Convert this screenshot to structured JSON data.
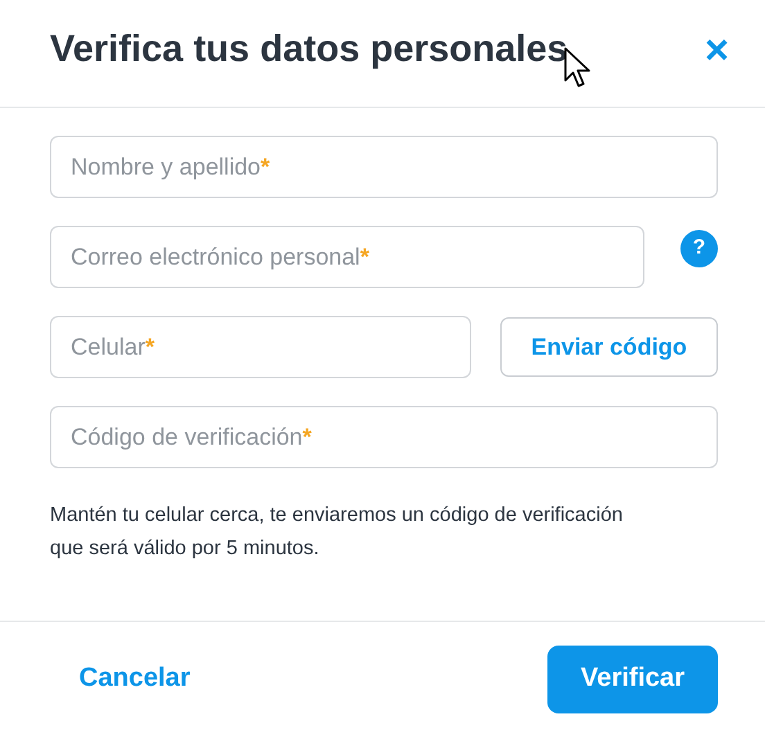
{
  "dialog": {
    "title": "Verifica tus datos personales",
    "close": "×"
  },
  "fields": [
    {
      "kind": "plain",
      "placeholder": "Nombre y apellido",
      "required_mark": "*"
    },
    {
      "kind": "help",
      "placeholder": "Correo electrónico personal",
      "required_mark": "*",
      "help": "?"
    },
    {
      "kind": "action",
      "placeholder": "Celular",
      "required_mark": "*",
      "action": "Enviar código"
    },
    {
      "kind": "plain",
      "placeholder": "Código de verificación",
      "required_mark": "*"
    }
  ],
  "note": "Mantén tu celular cerca, te enviaremos un código de verificación que será válido por 5 minutos.",
  "footer": {
    "cancel": "Cancelar",
    "submit": "Verificar"
  }
}
